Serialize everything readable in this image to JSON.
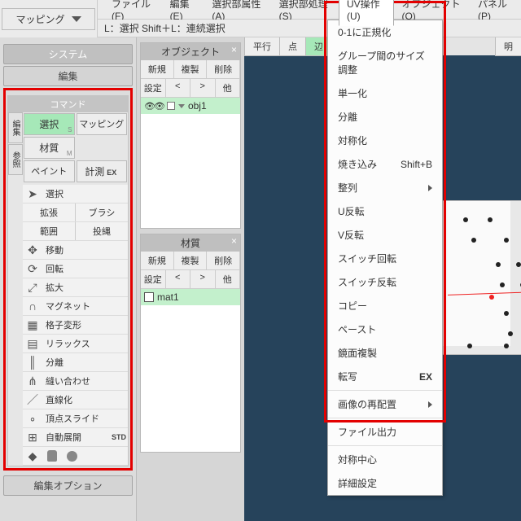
{
  "modeSelector": {
    "label": "マッピング"
  },
  "menubar": [
    "ファイル(F)",
    "編集(E)",
    "選択部属性(A)",
    "選択部処理(S)",
    "UV操作(U)",
    "オブジェクト(O)",
    "パネル(P)"
  ],
  "hint": "L：選択  Shift＋L：連続選択",
  "left": {
    "system": "システム",
    "edit": "編集",
    "cmd": "コマンド",
    "editopt": "編集オプション",
    "tabs": {
      "t1": "編集",
      "t2": "参照"
    },
    "b11": "選択",
    "b12": "マッピング",
    "b21": "材質",
    "b31": "ペイント",
    "b32": "計測",
    "b32b": "EX",
    "tools": {
      "sel": "選択",
      "exp": "拡張",
      "brush": "ブラシ",
      "range": "範囲",
      "lasso": "投縄",
      "move": "移動",
      "rot": "回転",
      "scale": "拡大",
      "mag": "マグネット",
      "lat": "格子変形",
      "relax": "リラックス",
      "split": "分離",
      "sew": "縫い合わせ",
      "line": "直線化",
      "vslide": "頂点スライド",
      "auto": "自動展開",
      "autob": "STD"
    }
  },
  "objpanel": {
    "title": "オブジェクト",
    "new": "新規",
    "dup": "複製",
    "del": "削除",
    "set": "設定",
    "lt": "<",
    "gt": ">",
    "other": "他",
    "item": "obj1"
  },
  "matpanel": {
    "title": "材質",
    "new": "新規",
    "dup": "複製",
    "del": "削除",
    "set": "設定",
    "lt": "<",
    "gt": ">",
    "other": "他",
    "item": "mat1"
  },
  "mode": {
    "m1": "平行",
    "m2": "点",
    "m3": "辺",
    "m5": "明"
  },
  "uvmenu": {
    "i1": "0-1に正規化",
    "i2": "グループ間のサイズ調整",
    "i3": "単一化",
    "i4": "分離",
    "i5": "対称化",
    "i6": "焼き込み",
    "i6s": "Shift+B",
    "i7": "整列",
    "i8": "U反転",
    "i9": "V反転",
    "i10": "スイッチ回転",
    "i11": "スイッチ反転",
    "i12": "コピー",
    "i13": "ペースト",
    "i14": "鏡面複製",
    "i15": "転写",
    "i15b": "EX",
    "i16": "画像の再配置",
    "i17": "ファイル出力",
    "i18": "対称中心",
    "i19": "詳細設定"
  }
}
